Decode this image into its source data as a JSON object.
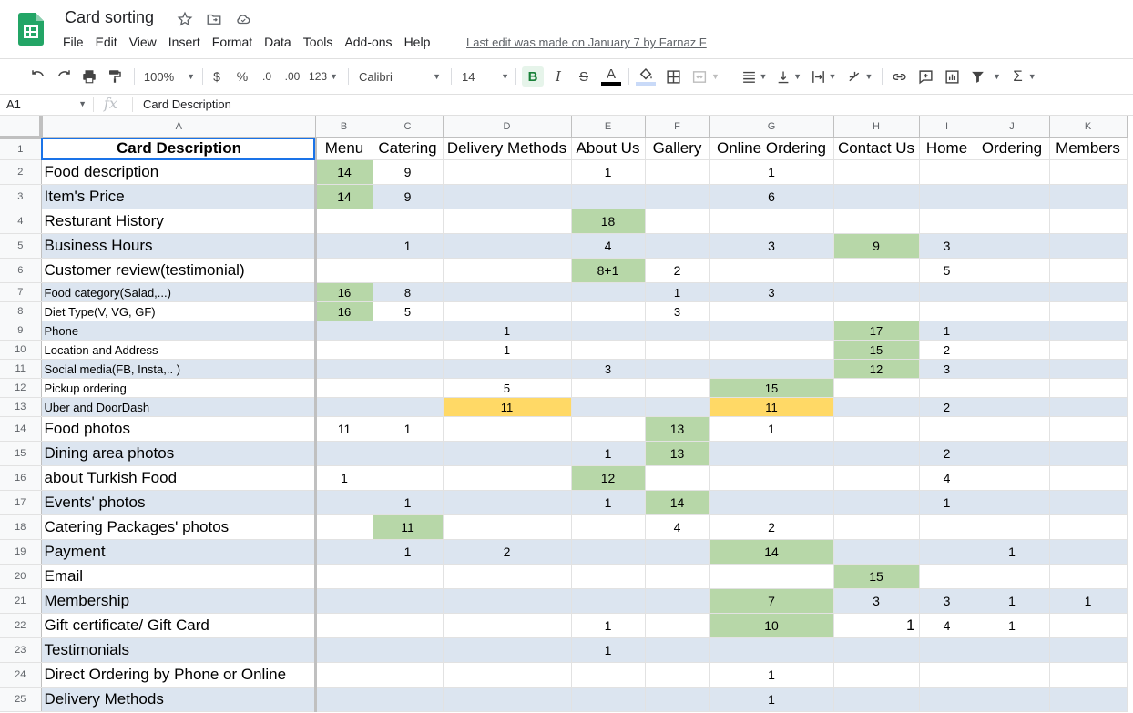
{
  "doc": {
    "title": "Card sorting",
    "menu": [
      "File",
      "Edit",
      "View",
      "Insert",
      "Format",
      "Data",
      "Tools",
      "Add-ons",
      "Help"
    ],
    "last_edit": "Last edit was made on January 7 by Farnaz F"
  },
  "toolbar": {
    "zoom": "100%",
    "currency": "$",
    "percent": "%",
    "dec_decrease": ".0",
    "dec_increase": ".00",
    "number_format": "123",
    "font": "Calibri",
    "font_size": "14",
    "bold": "B",
    "italic": "I",
    "strike": "S",
    "text_color": "A"
  },
  "formula_bar": {
    "cell_ref": "A1",
    "fx": "fx",
    "content": "Card Description"
  },
  "colors": {
    "green": "#b7d7a8",
    "yellow": "#ffd966",
    "band": "#dce5f0",
    "selection": "#1a73e8",
    "logo": "#23a566"
  },
  "columns": [
    "A",
    "B",
    "C",
    "D",
    "E",
    "F",
    "G",
    "H",
    "I",
    "J",
    "K"
  ],
  "rows": [
    {
      "n": "1",
      "cells": [
        "Card Description",
        "Menu",
        "Catering",
        "Delivery Methods",
        "About Us",
        "Gallery",
        "Online Ordering",
        "Contact Us",
        "Home",
        "Ordering",
        "Members"
      ]
    },
    {
      "n": "2",
      "cells": [
        "Food description",
        "14",
        "9",
        "",
        "1",
        "",
        "1",
        "",
        "",
        "",
        ""
      ]
    },
    {
      "n": "3",
      "cells": [
        "Item's Price",
        "14",
        "9",
        "",
        "",
        "",
        "6",
        "",
        "",
        "",
        ""
      ]
    },
    {
      "n": "4",
      "cells": [
        "Resturant History",
        "",
        "",
        "",
        "18",
        "",
        "",
        "",
        "",
        "",
        ""
      ]
    },
    {
      "n": "5",
      "cells": [
        "Business Hours",
        "",
        "1",
        "",
        "4",
        "",
        "3",
        "9",
        "3",
        "",
        ""
      ]
    },
    {
      "n": "6",
      "cells": [
        "Customer review(testimonial)",
        "",
        "",
        "",
        "8+1",
        "2",
        "",
        "",
        "5",
        "",
        ""
      ]
    },
    {
      "n": "7",
      "cells": [
        "Food category(Salad,...)",
        "16",
        "8",
        "",
        "",
        "1",
        "3",
        "",
        "",
        "",
        ""
      ]
    },
    {
      "n": "8",
      "cells": [
        "Diet Type(V, VG, GF)",
        "16",
        "5",
        "",
        "",
        "3",
        "",
        "",
        "",
        "",
        ""
      ]
    },
    {
      "n": "9",
      "cells": [
        "Phone",
        "",
        "",
        "1",
        "",
        "",
        "",
        "17",
        "1",
        "",
        ""
      ]
    },
    {
      "n": "10",
      "cells": [
        "Location and Address",
        "",
        "",
        "1",
        "",
        "",
        "",
        "15",
        "2",
        "",
        ""
      ]
    },
    {
      "n": "11",
      "cells": [
        "Social media(FB, Insta,.. )",
        "",
        "",
        "",
        "3",
        "",
        "",
        "12",
        "3",
        "",
        ""
      ]
    },
    {
      "n": "12",
      "cells": [
        "Pickup ordering",
        "",
        "",
        "5",
        "",
        "",
        "15",
        "",
        "",
        "",
        ""
      ]
    },
    {
      "n": "13",
      "cells": [
        "Uber and DoorDash",
        "",
        "",
        "11",
        "",
        "",
        "11",
        "",
        "2",
        "",
        ""
      ]
    },
    {
      "n": "14",
      "cells": [
        "Food photos",
        "11",
        "1",
        "",
        "",
        "13",
        "1",
        "",
        "",
        "",
        ""
      ]
    },
    {
      "n": "15",
      "cells": [
        "Dining area photos",
        "",
        "",
        "",
        "1",
        "13",
        "",
        "",
        "2",
        "",
        ""
      ]
    },
    {
      "n": "16",
      "cells": [
        "about Turkish Food",
        "1",
        "",
        "",
        "12",
        "",
        "",
        "",
        "4",
        "",
        ""
      ]
    },
    {
      "n": "17",
      "cells": [
        "Events' photos",
        "",
        "1",
        "",
        "1",
        "14",
        "",
        "",
        "1",
        "",
        ""
      ]
    },
    {
      "n": "18",
      "cells": [
        "Catering Packages' photos",
        "",
        "11",
        "",
        "",
        "4",
        "2",
        "",
        "",
        "",
        ""
      ]
    },
    {
      "n": "19",
      "cells": [
        "Payment",
        "",
        "1",
        "2",
        "",
        "",
        "14",
        "",
        "",
        "1",
        ""
      ]
    },
    {
      "n": "20",
      "cells": [
        "Email",
        "",
        "",
        "",
        "",
        "",
        "",
        "15",
        "",
        "",
        ""
      ]
    },
    {
      "n": "21",
      "cells": [
        "Membership",
        "",
        "",
        "",
        "",
        "",
        "7",
        "3",
        "3",
        "1",
        "1"
      ]
    },
    {
      "n": "22",
      "cells": [
        "Gift certificate/ Gift Card",
        "",
        "",
        "",
        "1",
        "",
        "10",
        "1",
        "4",
        "1",
        ""
      ]
    },
    {
      "n": "23",
      "cells": [
        "Testimonials",
        "",
        "",
        "",
        "1",
        "",
        "",
        "",
        "",
        "",
        ""
      ]
    },
    {
      "n": "24",
      "cells": [
        "Direct Ordering by Phone or Online",
        "",
        "",
        "",
        "",
        "",
        "1",
        "",
        "",
        "",
        ""
      ]
    },
    {
      "n": "25",
      "cells": [
        "Delivery Methods",
        "",
        "",
        "",
        "",
        "",
        "1",
        "",
        "",
        "",
        ""
      ]
    }
  ]
}
